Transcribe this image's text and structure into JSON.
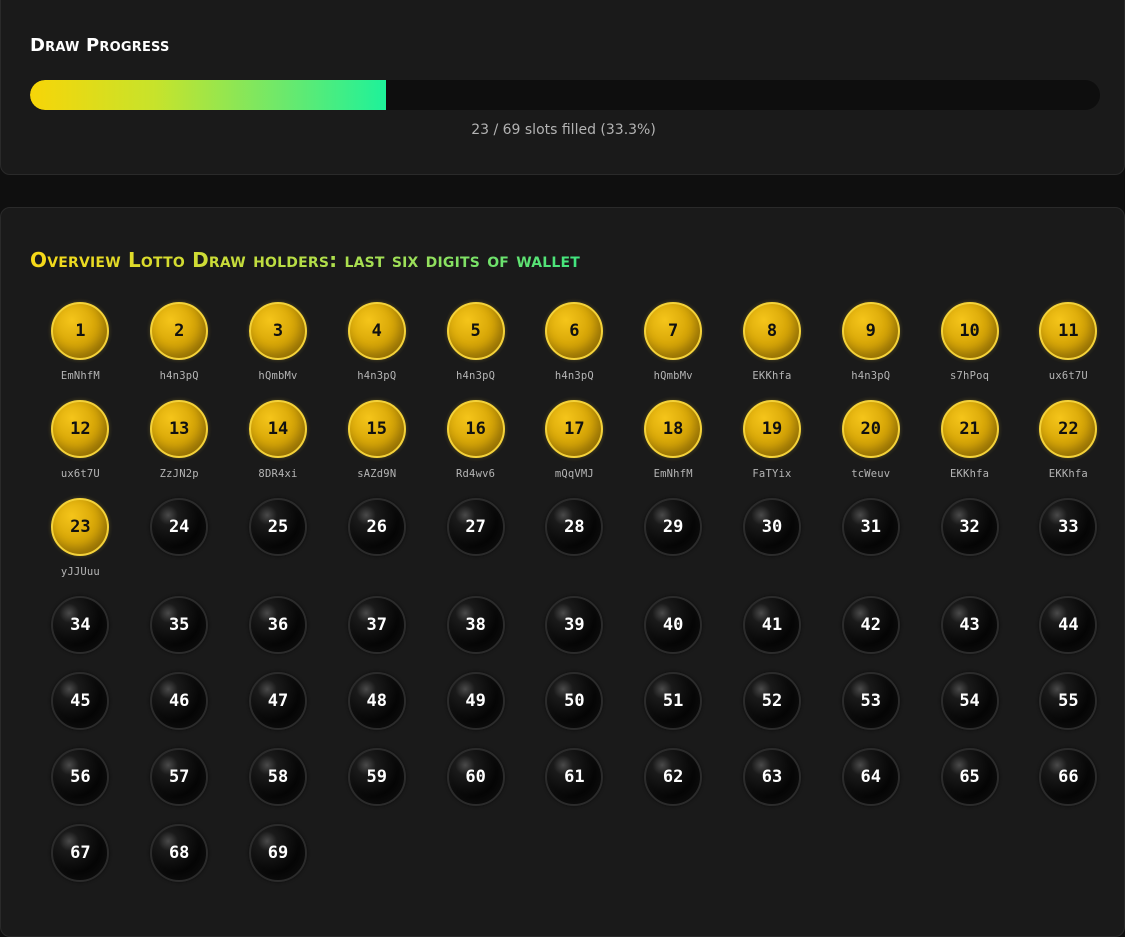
{
  "progress": {
    "title": "Draw Progress",
    "filled": 23,
    "total": 69,
    "status_text": "23 / 69 slots filled (33.3%)",
    "percent": 33.3,
    "gradient_colors": [
      "#f7d508",
      "#1ef29a"
    ]
  },
  "overview": {
    "title": "Overview Lotto Draw holders: last six digits of wallet",
    "slots": [
      {
        "number": "1",
        "wallet": "EmNhfM"
      },
      {
        "number": "2",
        "wallet": "h4n3pQ"
      },
      {
        "number": "3",
        "wallet": "hQmbMv"
      },
      {
        "number": "4",
        "wallet": "h4n3pQ"
      },
      {
        "number": "5",
        "wallet": "h4n3pQ"
      },
      {
        "number": "6",
        "wallet": "h4n3pQ"
      },
      {
        "number": "7",
        "wallet": "hQmbMv"
      },
      {
        "number": "8",
        "wallet": "EKKhfa"
      },
      {
        "number": "9",
        "wallet": "h4n3pQ"
      },
      {
        "number": "10",
        "wallet": "s7hPoq"
      },
      {
        "number": "11",
        "wallet": "ux6t7U"
      },
      {
        "number": "12",
        "wallet": "ux6t7U"
      },
      {
        "number": "13",
        "wallet": "ZzJN2p"
      },
      {
        "number": "14",
        "wallet": "8DR4xi"
      },
      {
        "number": "15",
        "wallet": "sAZd9N"
      },
      {
        "number": "16",
        "wallet": "Rd4wv6"
      },
      {
        "number": "17",
        "wallet": "mQqVMJ"
      },
      {
        "number": "18",
        "wallet": "EmNhfM"
      },
      {
        "number": "19",
        "wallet": "FaTYix"
      },
      {
        "number": "20",
        "wallet": "tcWeuv"
      },
      {
        "number": "21",
        "wallet": "EKKhfa"
      },
      {
        "number": "22",
        "wallet": "EKKhfa"
      },
      {
        "number": "23",
        "wallet": "yJJUuu"
      },
      {
        "number": "24",
        "wallet": null
      },
      {
        "number": "25",
        "wallet": null
      },
      {
        "number": "26",
        "wallet": null
      },
      {
        "number": "27",
        "wallet": null
      },
      {
        "number": "28",
        "wallet": null
      },
      {
        "number": "29",
        "wallet": null
      },
      {
        "number": "30",
        "wallet": null
      },
      {
        "number": "31",
        "wallet": null
      },
      {
        "number": "32",
        "wallet": null
      },
      {
        "number": "33",
        "wallet": null
      },
      {
        "number": "34",
        "wallet": null
      },
      {
        "number": "35",
        "wallet": null
      },
      {
        "number": "36",
        "wallet": null
      },
      {
        "number": "37",
        "wallet": null
      },
      {
        "number": "38",
        "wallet": null
      },
      {
        "number": "39",
        "wallet": null
      },
      {
        "number": "40",
        "wallet": null
      },
      {
        "number": "41",
        "wallet": null
      },
      {
        "number": "42",
        "wallet": null
      },
      {
        "number": "43",
        "wallet": null
      },
      {
        "number": "44",
        "wallet": null
      },
      {
        "number": "45",
        "wallet": null
      },
      {
        "number": "46",
        "wallet": null
      },
      {
        "number": "47",
        "wallet": null
      },
      {
        "number": "48",
        "wallet": null
      },
      {
        "number": "49",
        "wallet": null
      },
      {
        "number": "50",
        "wallet": null
      },
      {
        "number": "51",
        "wallet": null
      },
      {
        "number": "52",
        "wallet": null
      },
      {
        "number": "53",
        "wallet": null
      },
      {
        "number": "54",
        "wallet": null
      },
      {
        "number": "55",
        "wallet": null
      },
      {
        "number": "56",
        "wallet": null
      },
      {
        "number": "57",
        "wallet": null
      },
      {
        "number": "58",
        "wallet": null
      },
      {
        "number": "59",
        "wallet": null
      },
      {
        "number": "60",
        "wallet": null
      },
      {
        "number": "61",
        "wallet": null
      },
      {
        "number": "62",
        "wallet": null
      },
      {
        "number": "63",
        "wallet": null
      },
      {
        "number": "64",
        "wallet": null
      },
      {
        "number": "65",
        "wallet": null
      },
      {
        "number": "66",
        "wallet": null
      },
      {
        "number": "67",
        "wallet": null
      },
      {
        "number": "68",
        "wallet": null
      },
      {
        "number": "69",
        "wallet": null
      }
    ]
  },
  "colors": {
    "background": "#0f0f0f",
    "panel": "#1a1a1a",
    "gold_ball": "#d9a808",
    "gold_border": "#f4d23a",
    "black_ball": "#050505",
    "wallet_text": "#b5b5b5"
  }
}
